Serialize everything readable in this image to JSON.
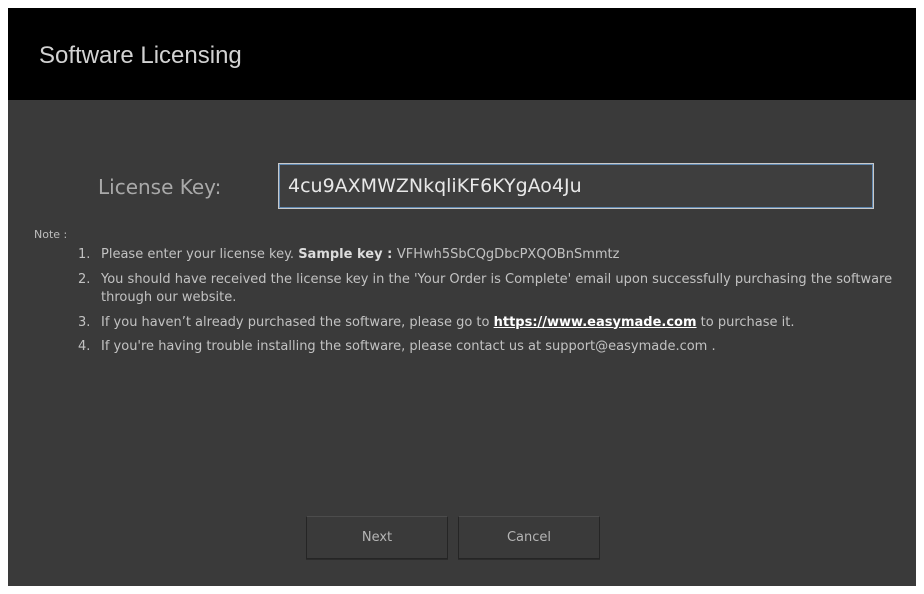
{
  "window": {
    "title": "Software Licensing"
  },
  "license": {
    "label": "License Key:",
    "value": "4cu9AXMWZNkqliKF6KYgAo4Ju"
  },
  "notes": {
    "heading": "Note :",
    "items": [
      {
        "num": "1.",
        "text": "Please enter your license key.",
        "bold": "Sample key",
        "sep": " : ",
        "sample": "VFHwh5SbCQgDbcPXQOBnSmmtz"
      },
      {
        "num": "2.",
        "text": "You should have received the license key in the 'Your Order is Complete' email upon successfully purchasing the software through our website."
      },
      {
        "num": "3.",
        "text_before": "If you haven’t already purchased the software, please go to ",
        "link": "https://www.easymade.com",
        "text_after": " to purchase it."
      },
      {
        "num": "4.",
        "text": "If you're having trouble installing the software, please contact us at support@easymade.com ."
      }
    ]
  },
  "buttons": {
    "next": "Next",
    "cancel": "Cancel"
  }
}
